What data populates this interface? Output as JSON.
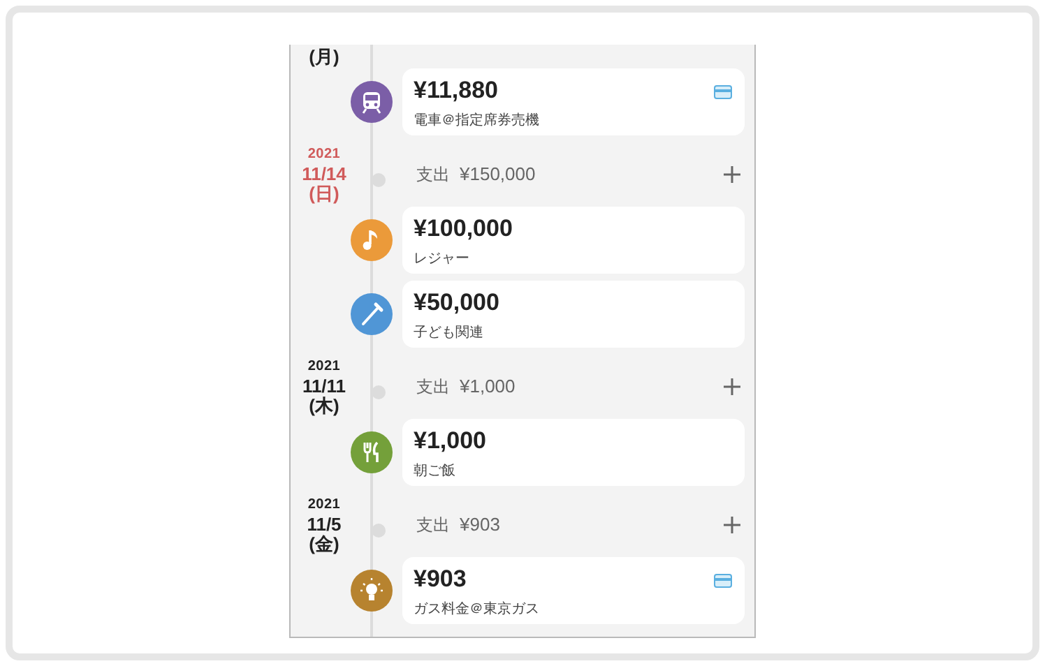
{
  "entries": [
    {
      "kind": "date",
      "weekday": "(月)"
    },
    {
      "kind": "train",
      "color": "#7b5ea7",
      "amount": "¥11,880",
      "note": "電車＠指定席券売機",
      "card": true
    },
    {
      "kind": "date",
      "year": "2021",
      "date": "11/14",
      "weekday": "(日)",
      "holiday": true,
      "total_label": "支出",
      "total": "¥150,000"
    },
    {
      "kind": "music",
      "color": "#eb9a3a",
      "amount": "¥100,000",
      "note": "レジャー",
      "card": false
    },
    {
      "kind": "brush",
      "color": "#5096d6",
      "amount": "¥50,000",
      "note": "子ども関連",
      "card": false
    },
    {
      "kind": "date",
      "year": "2021",
      "date": "11/11",
      "weekday": "(木)",
      "holiday": false,
      "total_label": "支出",
      "total": "¥1,000"
    },
    {
      "kind": "dining",
      "color": "#74a03a",
      "amount": "¥1,000",
      "note": "朝ご飯",
      "card": false
    },
    {
      "kind": "date",
      "year": "2021",
      "date": "11/5",
      "weekday": "(金)",
      "holiday": false,
      "total_label": "支出",
      "total": "¥903"
    },
    {
      "kind": "bulb",
      "color": "#b7832f",
      "amount": "¥903",
      "note": "ガス料金＠東京ガス",
      "card": true
    }
  ]
}
